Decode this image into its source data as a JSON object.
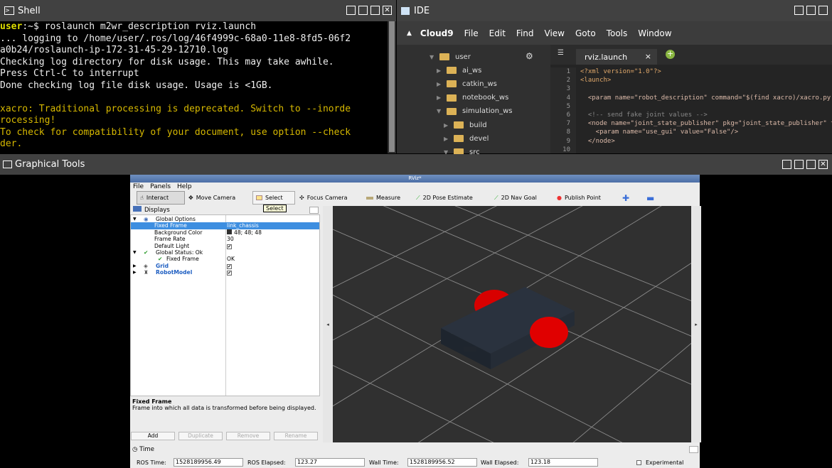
{
  "shell": {
    "title": "Shell",
    "lines": [
      {
        "prompt_user": "user",
        "prompt_rest": ":~$ ",
        "text": "roslaunch m2wr_description rviz.launch",
        "type": "cmd"
      },
      {
        "text": "... logging to /home/user/.ros/log/46f4999c-68a0-11e8-8fd5-06f2",
        "type": "out"
      },
      {
        "text": "a0b24/roslaunch-ip-172-31-45-29-12710.log",
        "type": "out"
      },
      {
        "text": "Checking log directory for disk usage. This may take awhile.",
        "type": "out"
      },
      {
        "text": "Press Ctrl-C to interrupt",
        "type": "out"
      },
      {
        "text": "Done checking log file disk usage. Usage is <1GB.",
        "type": "out"
      },
      {
        "text": "",
        "type": "out"
      },
      {
        "text": "xacro: Traditional processing is deprecated. Switch to --inorde",
        "type": "warn"
      },
      {
        "text": "rocessing!",
        "type": "warn"
      },
      {
        "text": "To check for compatibility of your document, use option --check",
        "type": "warn"
      },
      {
        "text": "der.",
        "type": "warn"
      },
      {
        "text": "...",
        "type": "out"
      }
    ]
  },
  "ide": {
    "title": "IDE",
    "menu": [
      "Cloud9",
      "File",
      "Edit",
      "Find",
      "View",
      "Goto",
      "Tools",
      "Window"
    ],
    "tree": [
      {
        "label": "user",
        "level": 0,
        "open": true
      },
      {
        "label": "ai_ws",
        "level": 1,
        "open": false
      },
      {
        "label": "catkin_ws",
        "level": 1,
        "open": false
      },
      {
        "label": "notebook_ws",
        "level": 1,
        "open": false
      },
      {
        "label": "simulation_ws",
        "level": 1,
        "open": true
      },
      {
        "label": "build",
        "level": 2,
        "open": false
      },
      {
        "label": "devel",
        "level": 2,
        "open": false
      },
      {
        "label": "src",
        "level": 2,
        "open": true
      }
    ],
    "tab": "rviz.launch",
    "line_numbers": [
      "1",
      "2",
      "3",
      "4",
      "5",
      "6",
      "7",
      "8",
      "9",
      "10"
    ],
    "code": [
      "<?xml version=\"1.0\"?>",
      "<launch>",
      "",
      "  <param name=\"robot_description\" command=\"$(find xacro)/xacro.py",
      "",
      "  <!-- send fake joint values -->",
      "  <node name=\"joint_state_publisher\" pkg=\"joint_state_publisher\" ty",
      "    <param name=\"use_gui\" value=\"False\"/>",
      "  </node>",
      ""
    ]
  },
  "graphical": {
    "title": "Graphical Tools"
  },
  "rviz": {
    "title": "RViz*",
    "menu": [
      "File",
      "Panels",
      "Help"
    ],
    "tools": [
      "Interact",
      "Move Camera",
      "Select",
      "Focus Camera",
      "Measure",
      "2D Pose Estimate",
      "2D Nav Goal",
      "Publish Point"
    ],
    "tooltip": "Select",
    "displays_title": "Displays",
    "tree": [
      {
        "key": "Global Options",
        "value": "",
        "indent": 0,
        "arrow": "▼",
        "icon": "globe",
        "selected": false
      },
      {
        "key": "Fixed Frame",
        "value": "link_chassis",
        "indent": 1,
        "selected": true
      },
      {
        "key": "Background Color",
        "value": "48; 48; 48",
        "indent": 1,
        "swatch": true,
        "selected": false
      },
      {
        "key": "Frame Rate",
        "value": "30",
        "indent": 1,
        "selected": false
      },
      {
        "key": "Default Light",
        "value": "✔",
        "indent": 1,
        "check": true,
        "selected": false
      },
      {
        "key": "Global Status: Ok",
        "value": "",
        "indent": 0,
        "arrow": "▼",
        "icon": "ok",
        "selected": false
      },
      {
        "key": "Fixed Frame",
        "value": "OK",
        "indent": 1,
        "icon": "ok",
        "selected": false
      },
      {
        "key": "Grid",
        "value": "✔",
        "indent": 0,
        "arrow": "▶",
        "icon": "grid",
        "check": true,
        "bold": true,
        "selected": false
      },
      {
        "key": "RobotModel",
        "value": "✔",
        "indent": 0,
        "arrow": "▶",
        "icon": "robot",
        "check": true,
        "bold": true,
        "selected": false
      }
    ],
    "desc_title": "Fixed Frame",
    "desc_text": "Frame into which all data is transformed before being displayed.",
    "buttons": [
      "Add",
      "Duplicate",
      "Remove",
      "Rename"
    ],
    "time_title": "Time",
    "ros_time_label": "ROS Time:",
    "ros_time": "1528189956.49",
    "ros_elapsed_label": "ROS Elapsed:",
    "ros_elapsed": "123.27",
    "wall_time_label": "Wall Time:",
    "wall_time": "1528189956.52",
    "wall_elapsed_label": "Wall Elapsed:",
    "wall_elapsed": "123.18",
    "experimental": "Experimental"
  },
  "colors": {
    "prompt": "#dede00",
    "warn": "#d6b800",
    "robot_body": "#2a323e",
    "wheel": "#e00000",
    "bg": "#303030"
  }
}
